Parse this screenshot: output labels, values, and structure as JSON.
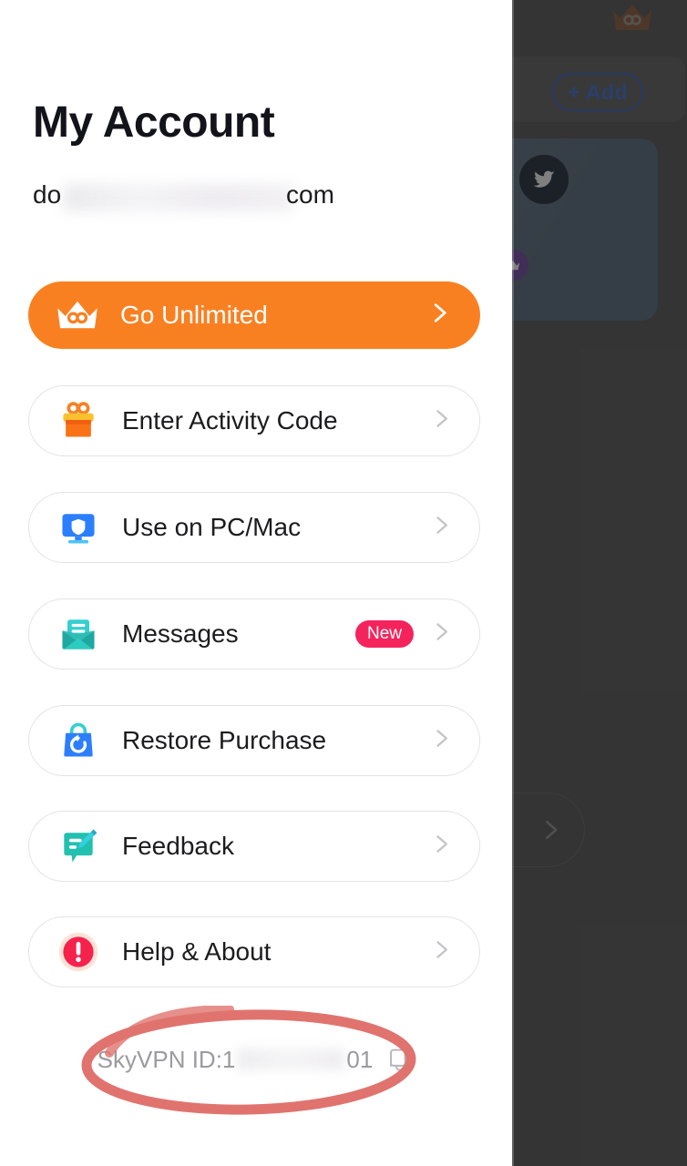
{
  "drawer": {
    "title": "My Account",
    "email": {
      "prefix": "do",
      "suffix": "com",
      "redacted": true
    },
    "promo": {
      "label": "Go Unlimited",
      "icon": "crown-infinity-icon",
      "chevron": "chevron-right-icon",
      "color": "#F98021"
    },
    "menu_items": [
      {
        "label": "Enter Activity Code",
        "icon": "gift-box-icon",
        "badge": null,
        "chevron": "chevron-right-icon"
      },
      {
        "label": "Use on PC/Mac",
        "icon": "monitor-shield-icon",
        "badge": null,
        "chevron": "chevron-right-icon"
      },
      {
        "label": "Messages",
        "icon": "envelope-icon",
        "badge": "New",
        "chevron": "chevron-right-icon"
      },
      {
        "label": "Restore Purchase",
        "icon": "shopping-bag-restore-icon",
        "badge": null,
        "chevron": "chevron-right-icon"
      },
      {
        "label": "Feedback",
        "icon": "speech-bubble-pencil-icon",
        "badge": null,
        "chevron": "chevron-right-icon"
      },
      {
        "label": "Help & About",
        "icon": "exclamation-circle-icon",
        "badge": null,
        "chevron": "chevron-right-icon"
      }
    ],
    "footer": {
      "id_prefix": "SkyVPN ID:1",
      "id_suffix": "01",
      "copy_icon": "copy-icon",
      "annotation": "red-circle-highlight"
    }
  },
  "background": {
    "crown_icon": "crown-infinity-icon",
    "add_button": "+ Add",
    "card": {
      "avatar": "unicorn-mascot-icon",
      "social_icon": "twitter-icon",
      "badge_icon": "crown-badge-icon"
    },
    "chevron": "chevron-right-icon"
  },
  "colors": {
    "accent_orange": "#F98021",
    "badge_pink": "#F5235C",
    "alert_red": "#F5224C",
    "blue": "#2B7FFF",
    "teal": "#2BC4B4",
    "text_primary": "#1C1C1E",
    "text_muted": "#9B9B9F",
    "row_border": "#E3E3E6",
    "annotation_red": "#E0736E"
  }
}
